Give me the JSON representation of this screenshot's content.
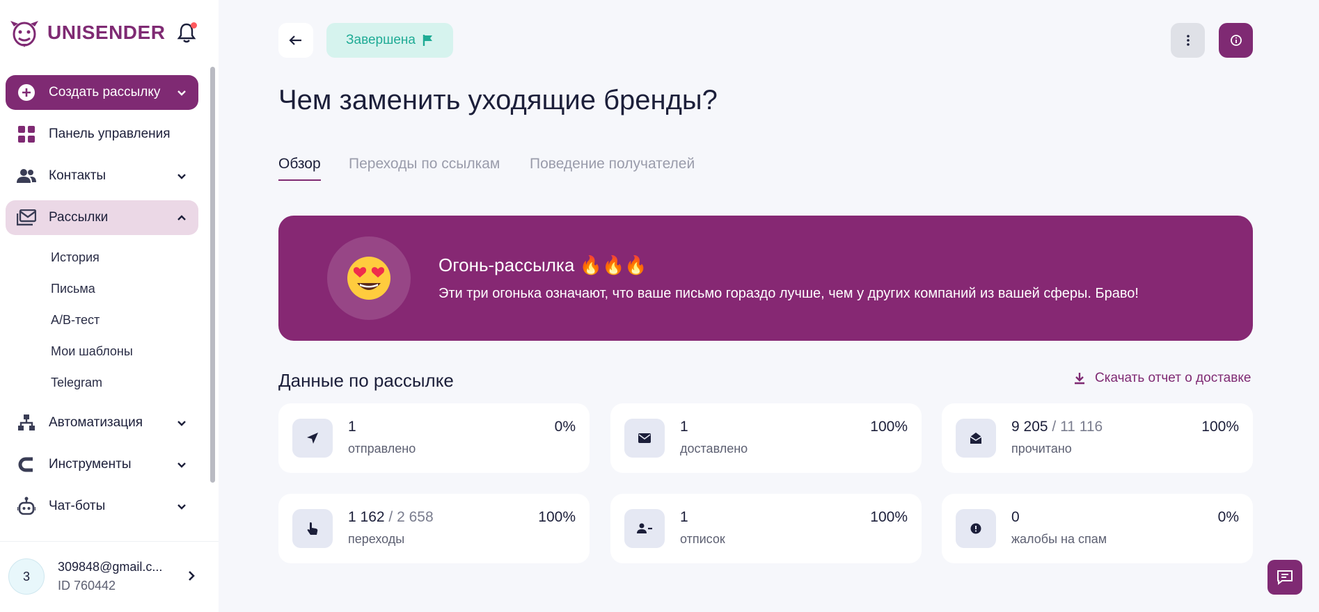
{
  "sidebar": {
    "logo_text": "UNISENDER",
    "nav": {
      "create": "Создать рассылку",
      "dashboard": "Панель управления",
      "contacts": "Контакты",
      "campaigns": "Рассылки",
      "automation": "Автоматизация",
      "tools": "Инструменты",
      "chatbots": "Чат-боты"
    },
    "sub_items": [
      "История",
      "Письма",
      "A/B-тест",
      "Мои шаблоны",
      "Telegram"
    ],
    "account": {
      "avatar": "3",
      "email": "309848@gmail.c...",
      "id": "ID 760442"
    }
  },
  "header": {
    "status": "Завершена",
    "title": "Чем заменить уходящие бренды?"
  },
  "tabs": [
    "Обзор",
    "Переходы по ссылкам",
    "Поведение получателей"
  ],
  "banner": {
    "emoji": "😍",
    "title": "Огонь-рассылка 🔥🔥🔥",
    "text": "Эти три огонька означают, что ваше письмо гораздо лучше, чем у других компаний из вашей сферы. Браво!"
  },
  "stats": {
    "title": "Данные по рассылке",
    "download": "Скачать отчет о доставке",
    "cards": [
      {
        "icon": "send-icon",
        "value": "1",
        "total": "",
        "label": "отправлено",
        "pct": "0%"
      },
      {
        "icon": "envelope-icon",
        "value": "1",
        "total": "",
        "label": "доставлено",
        "pct": "100%"
      },
      {
        "icon": "open-envelope-icon",
        "value": "9 205",
        "total": " / 11 116",
        "label": "прочитано",
        "pct": "100%"
      },
      {
        "icon": "pointer-hand-icon",
        "value": "1 162",
        "total": " / 2 658",
        "label": "переходы",
        "pct": "100%"
      },
      {
        "icon": "user-minus-icon",
        "value": "1",
        "total": "",
        "label": "отписок",
        "pct": "100%"
      },
      {
        "icon": "alert-icon",
        "value": "0",
        "total": "",
        "label": "жалобы на спам",
        "pct": "0%"
      }
    ]
  },
  "colors": {
    "brand": "#7f2a73",
    "banner": "#862873",
    "status_bg": "#d6f3ee",
    "status_text": "#1fab95"
  }
}
